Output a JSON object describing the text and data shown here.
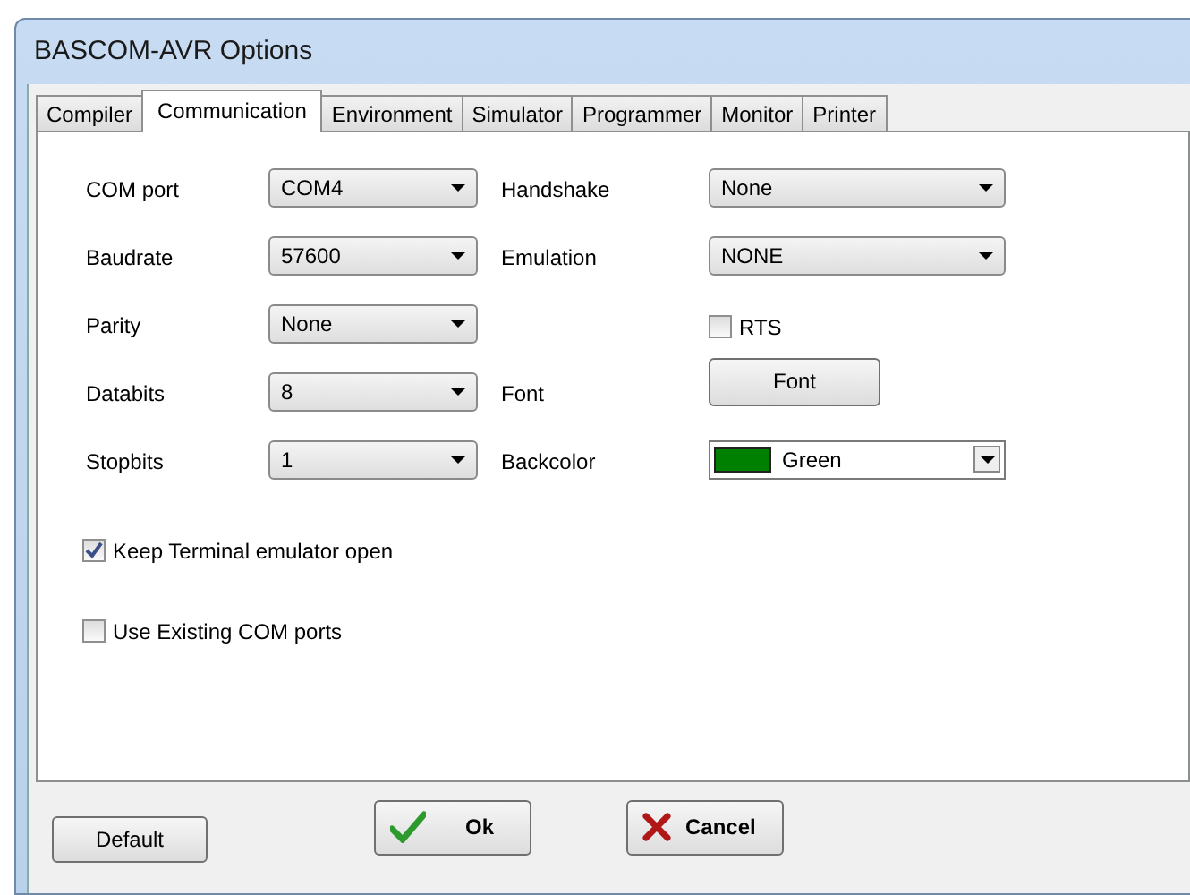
{
  "window": {
    "title": "BASCOM-AVR Options"
  },
  "tabs": [
    {
      "label": "Compiler",
      "selected": false
    },
    {
      "label": "Communication",
      "selected": true
    },
    {
      "label": "Environment",
      "selected": false
    },
    {
      "label": "Simulator",
      "selected": false
    },
    {
      "label": "Programmer",
      "selected": false
    },
    {
      "label": "Monitor",
      "selected": false
    },
    {
      "label": "Printer",
      "selected": false
    }
  ],
  "left_fields": [
    {
      "label": "COM port",
      "value": "COM4"
    },
    {
      "label": "Baudrate",
      "value": "57600"
    },
    {
      "label": "Parity",
      "value": "None"
    },
    {
      "label": "Databits",
      "value": "8"
    },
    {
      "label": "Stopbits",
      "value": "1"
    }
  ],
  "right_fields": [
    {
      "kind": "select",
      "label": "Handshake",
      "value": "None"
    },
    {
      "kind": "select",
      "label": "Emulation",
      "value": "NONE"
    },
    {
      "kind": "checkbox",
      "label": "RTS",
      "checked": false
    },
    {
      "kind": "button",
      "label": "Font",
      "caption": "Font"
    },
    {
      "kind": "color",
      "label": "Backcolor",
      "value": "Green",
      "color": "#008000"
    }
  ],
  "options": [
    {
      "label": "Keep Terminal emulator open",
      "checked": true
    },
    {
      "label": "Use Existing COM ports",
      "checked": false
    }
  ],
  "buttons": [
    {
      "kind": "plain",
      "label": "Default"
    },
    {
      "kind": "ok",
      "label": "Ok"
    },
    {
      "kind": "cancel",
      "label": "Cancel"
    }
  ]
}
